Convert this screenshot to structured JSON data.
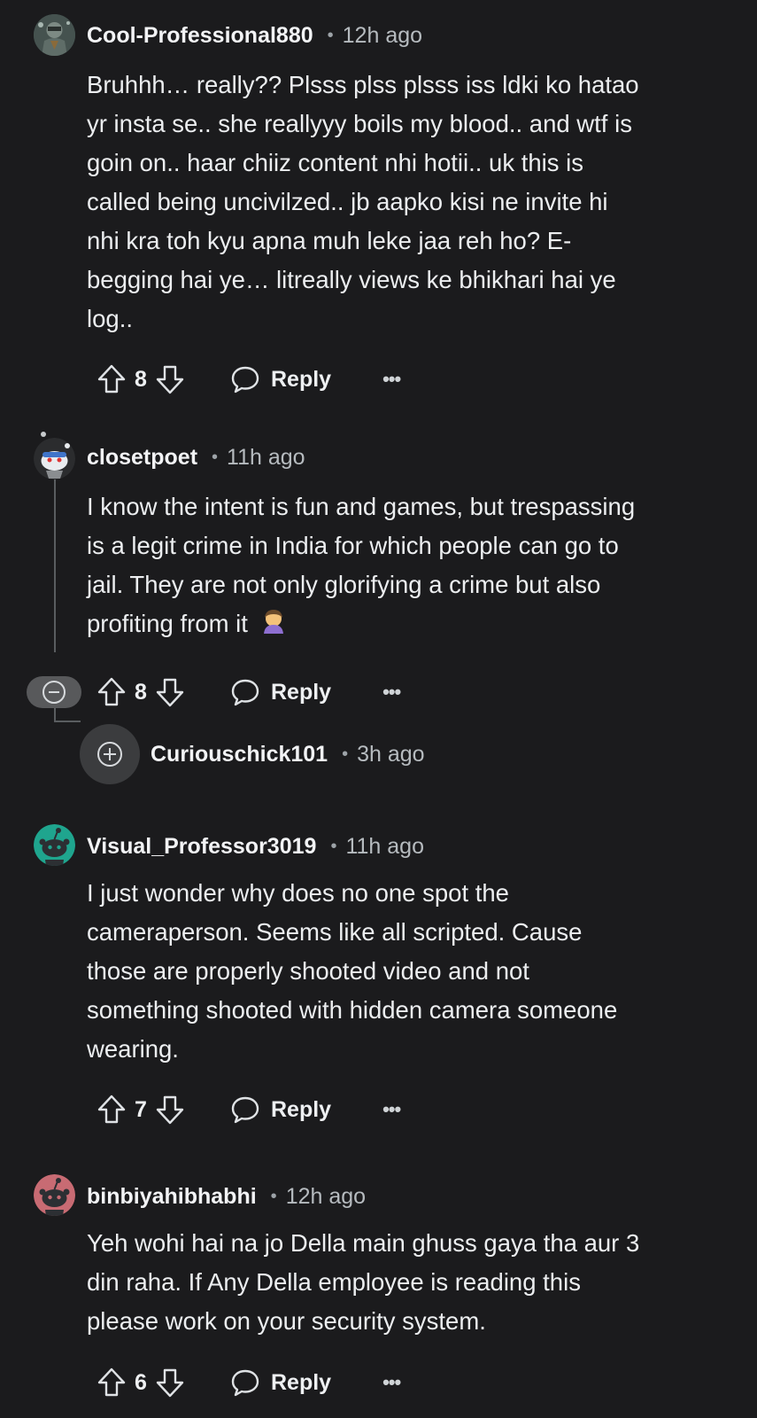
{
  "comments": [
    {
      "username": "Cool-Professional880",
      "time": "12h ago",
      "body": [
        "Bruhhh… really?? Plsss plss plsss iss ldki ko hatao",
        "yr insta se.. she reallyyy boils my blood.. and wtf is",
        "goin on.. haar chiiz content nhi hotii.. uk this is",
        "called being uncivilzed.. jb aapko kisi ne invite hi",
        "nhi kra toh kyu apna muh leke jaa reh ho? E-",
        "begging hai ye… litreally views ke bhikhari hai ye",
        "log.."
      ],
      "score": "8",
      "reply_label": "Reply",
      "more_label": "•••",
      "avatar_icon": "knight-avatar-icon"
    },
    {
      "username": "closetpoet",
      "time": "11h ago",
      "body": [
        "I know the intent is fun and games, but trespassing",
        "is a legit crime in India for which people can go to",
        "jail. They are not only glorifying a crime but also",
        "profiting from it"
      ],
      "score": "8",
      "reply_label": "Reply",
      "more_label": "•••",
      "avatar_icon": "snoo-avatar-icon",
      "emoji": "facepalm-emoji-icon"
    },
    {
      "username": "Curiouschick101",
      "time": "3h ago",
      "collapsed": true
    },
    {
      "username": "Visual_Professor3019",
      "time": "11h ago",
      "body": [
        "I just wonder why does no one spot the",
        "cameraperson. Seems like all scripted. Cause",
        "those are properly shooted video and not",
        "something shooted with hidden camera someone",
        "wearing."
      ],
      "score": "7",
      "reply_label": "Reply",
      "more_label": "•••",
      "avatar_icon": "snoo-avatar-icon",
      "avatar_color": "#1fa58e"
    },
    {
      "username": "binbiyahibhabhi",
      "time": "12h ago",
      "body": [
        "Yeh wohi hai na jo Della main ghuss gaya tha aur 3",
        "din raha. If Any Della employee is reading this",
        "please work on your security system."
      ],
      "score": "6",
      "reply_label": "Reply",
      "more_label": "•••",
      "avatar_icon": "snoo-avatar-icon",
      "avatar_color": "#c86b73"
    }
  ],
  "icons": {
    "upvote": "upvote-arrow-icon",
    "downvote": "downvote-arrow-icon",
    "reply": "speech-bubble-icon",
    "more": "ellipsis-icon",
    "collapse": "minus-circle-icon",
    "expand": "plus-circle-icon"
  },
  "colors": {
    "background": "#1b1b1d",
    "text": "#eceef0",
    "muted": "#b6bbbf",
    "thread_line": "#5a5d60"
  }
}
